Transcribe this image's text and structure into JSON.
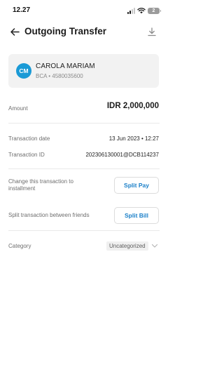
{
  "status_bar": {
    "time": "12.27",
    "battery_level": "2",
    "icons": [
      "signal-icon",
      "wifi-icon",
      "battery-icon"
    ]
  },
  "app_bar": {
    "title": "Outgoing Transfer",
    "icons": [
      "back-arrow-icon",
      "download-icon"
    ]
  },
  "recipient": {
    "initials": "CM",
    "name": "CAROLA MARIAM",
    "account": "BCA • 4580035600"
  },
  "amount": {
    "label": "Amount",
    "value": "IDR 2,000,000"
  },
  "details": {
    "date_label": "Transaction date",
    "date_value": "13 Jun 2023 • 12:27",
    "id_label": "Transaction ID",
    "id_value": "202306130001@DCB114237"
  },
  "actions": {
    "installment_label": "Change this transaction to installment",
    "split_pay_label": "Split Pay",
    "split_bill_text": "Split transaction between friends",
    "split_bill_label": "Split Bill"
  },
  "category": {
    "label": "Category",
    "value": "Uncategorized"
  },
  "colors": {
    "accent": "#1a7fc8",
    "avatar": "#1a9ad6",
    "card_bg": "#f2f2f2"
  }
}
